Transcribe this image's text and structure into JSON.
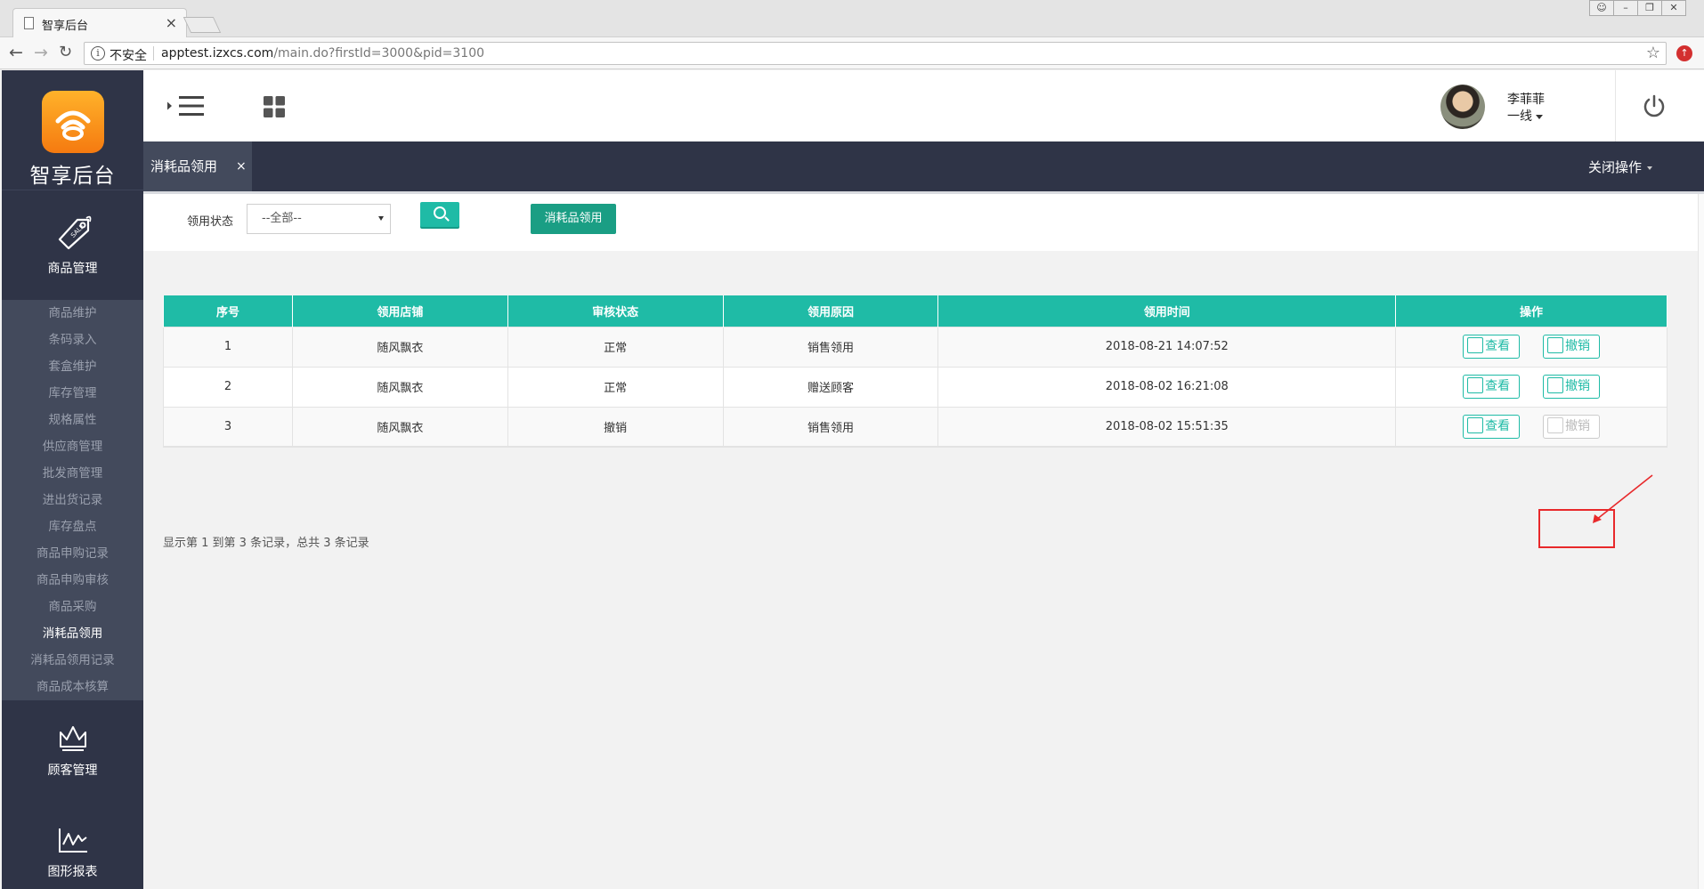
{
  "browser": {
    "tab_title": "智享后台",
    "tab_close": "×",
    "insecure_label": "不安全",
    "url_host": "apptest.izxcs.com",
    "url_path": "/main.do?firstId=3000&pid=3100",
    "window_controls": [
      "&#9821;",
      "—",
      "❐",
      "✕"
    ]
  },
  "sidebar": {
    "logo_text": "智享后台",
    "modules": [
      {
        "label": "商品管理",
        "icon": "sale-tag-icon"
      },
      {
        "label": "顾客管理",
        "icon": "crown-icon"
      },
      {
        "label": "图形报表",
        "icon": "line-chart-icon"
      }
    ],
    "submenu": [
      {
        "label": "商品维护",
        "active": false
      },
      {
        "label": "条码录入",
        "active": false
      },
      {
        "label": "套盒维护",
        "active": false
      },
      {
        "label": "库存管理",
        "active": false
      },
      {
        "label": "规格属性",
        "active": false
      },
      {
        "label": "供应商管理",
        "active": false
      },
      {
        "label": "批发商管理",
        "active": false
      },
      {
        "label": "进出货记录",
        "active": false
      },
      {
        "label": "库存盘点",
        "active": false
      },
      {
        "label": "商品申购记录",
        "active": false
      },
      {
        "label": "商品申购审核",
        "active": false
      },
      {
        "label": "商品采购",
        "active": false
      },
      {
        "label": "消耗品领用",
        "active": true
      },
      {
        "label": "消耗品领用记录",
        "active": false
      },
      {
        "label": "商品成本核算",
        "active": false
      }
    ]
  },
  "header": {
    "user_name": "李菲菲",
    "user_role": "一线"
  },
  "tabs": {
    "active_tab": "消耗品领用",
    "close_symbol": "×",
    "close_ops": "关闭操作"
  },
  "filter": {
    "status_label": "领用状态",
    "status_value": "--全部--",
    "action_button": "消耗品领用"
  },
  "table": {
    "columns": [
      "序号",
      "领用店铺",
      "审核状态",
      "领用原因",
      "领用时间",
      "操作"
    ],
    "rows": [
      {
        "no": "1",
        "store": "随风飘衣",
        "status": "正常",
        "reason": "销售领用",
        "time": "2018-08-21 14:07:52",
        "view": "查看",
        "revoke": "撤销",
        "revoke_enabled": true
      },
      {
        "no": "2",
        "store": "随风飘衣",
        "status": "正常",
        "reason": "赠送顾客",
        "time": "2018-08-02 16:21:08",
        "view": "查看",
        "revoke": "撤销",
        "revoke_enabled": true
      },
      {
        "no": "3",
        "store": "随风飘衣",
        "status": "撤销",
        "reason": "销售领用",
        "time": "2018-08-02 15:51:35",
        "view": "查看",
        "revoke": "撤销",
        "revoke_enabled": false
      }
    ],
    "footer": "显示第 1 到第 3 条记录，总共 3 条记录"
  },
  "colors": {
    "teal": "#1fbba6",
    "sidebar_bg": "#2f3447",
    "cancel_red": "#e8292b"
  }
}
